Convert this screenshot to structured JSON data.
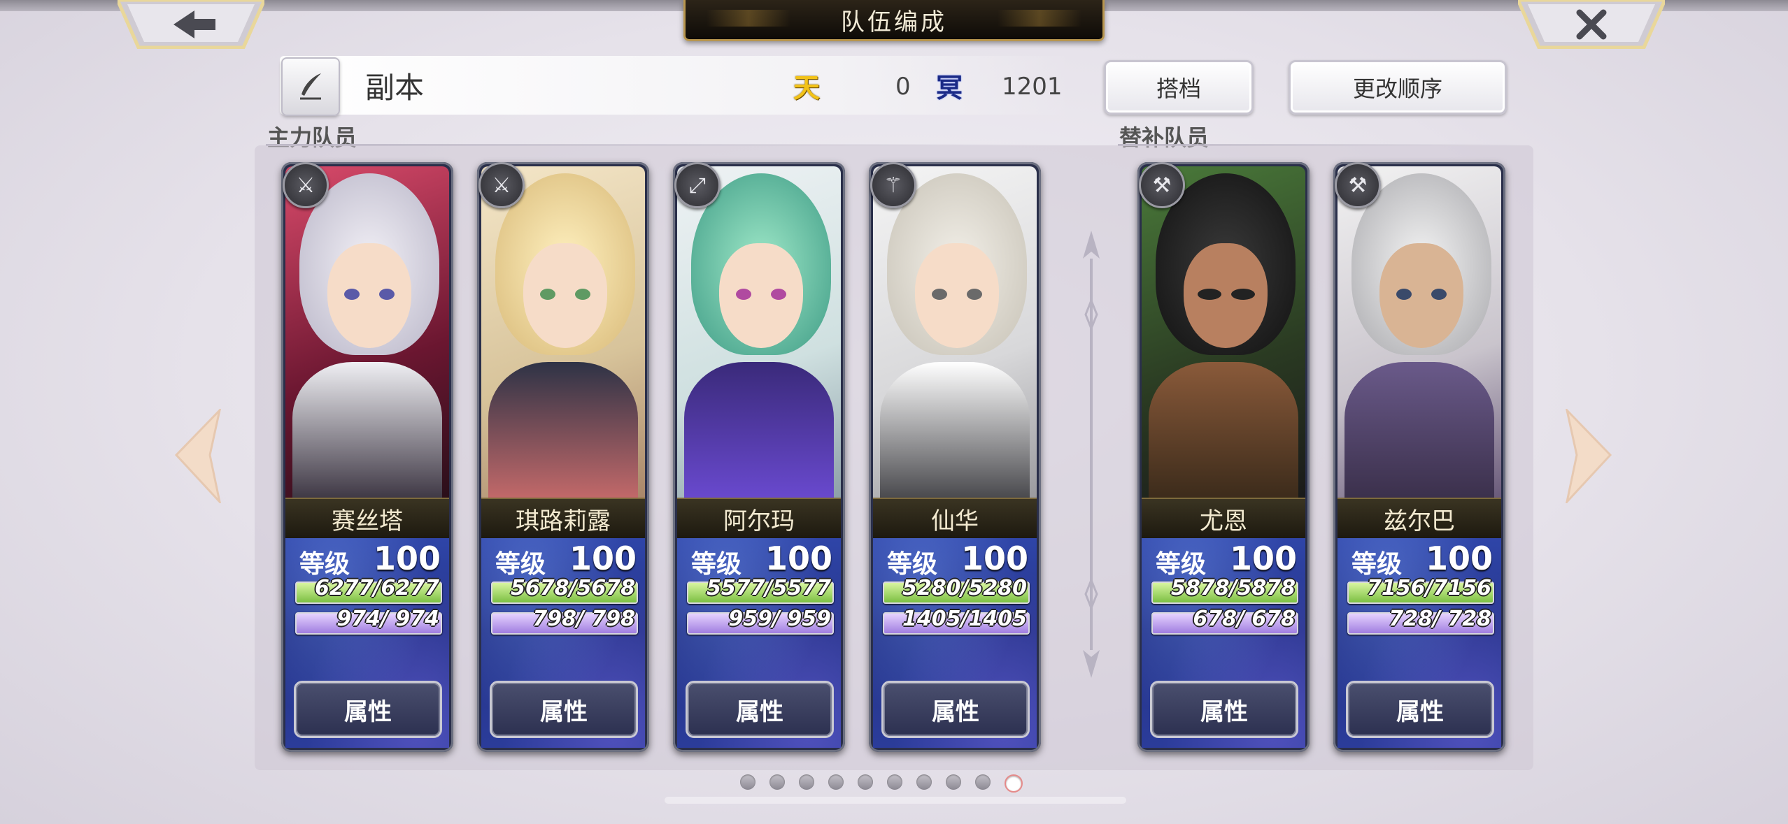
{
  "header": {
    "title": "队伍编成",
    "back_icon": "arrow-left-icon",
    "close_icon": "close-icon"
  },
  "team": {
    "name": "副本",
    "edit_icon": "quill-pen-icon",
    "heaven_badge": "天",
    "heaven_count": "0",
    "dark_badge": "冥",
    "dark_count": "1201"
  },
  "buttons": {
    "partner": "搭档",
    "reorder": "更改顺序"
  },
  "sections": {
    "main": "主力队员",
    "reserve": "替补队员"
  },
  "labels": {
    "level": "等级",
    "attribute": "属性"
  },
  "main_members": [
    {
      "name": "赛丝塔",
      "level": "100",
      "hp": "6277/6277",
      "mp": "974/ 974",
      "weapon": "sword-icon"
    },
    {
      "name": "琪路莉露",
      "level": "100",
      "hp": "5678/5678",
      "mp": "798/ 798",
      "weapon": "sword-icon"
    },
    {
      "name": "阿尔玛",
      "level": "100",
      "hp": "5577/5577",
      "mp": "959/ 959",
      "weapon": "bow-icon"
    },
    {
      "name": "仙华",
      "level": "100",
      "hp": "5280/5280",
      "mp": "1405/1405",
      "weapon": "staff-icon"
    }
  ],
  "reserve_members": [
    {
      "name": "尤恩",
      "level": "100",
      "hp": "5878/5878",
      "mp": "678/ 678",
      "weapon": "axe-icon"
    },
    {
      "name": "兹尔巴",
      "level": "100",
      "hp": "7156/7156",
      "mp": "728/ 728",
      "weapon": "axe-icon"
    }
  ],
  "pagination": {
    "total": 10,
    "active": 10
  },
  "colors": {
    "accent_gold": "#b8964e",
    "stat_blue": "#2f45a8",
    "hp_green": "#7cc043",
    "mp_purple": "#a07ee0"
  }
}
